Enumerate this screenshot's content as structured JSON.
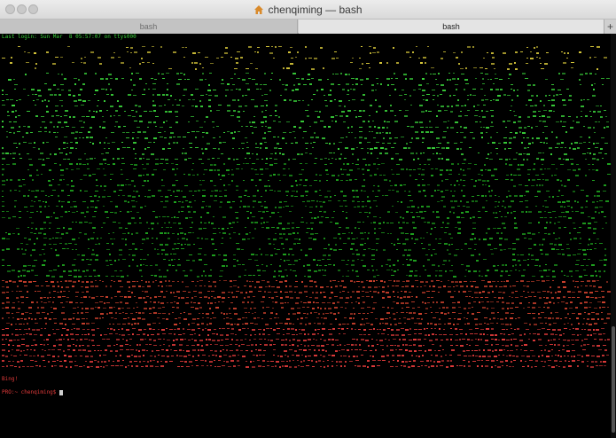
{
  "window": {
    "title": "chenqiming — bash",
    "title_icon": "home-icon"
  },
  "tabs": [
    {
      "label": "bash",
      "active": false
    },
    {
      "label": "bash",
      "active": true
    }
  ],
  "tab_add_label": "+",
  "terminal": {
    "login_line": "Last login: Sun Mar  8 05:57:07 on ttys000",
    "art_colors": {
      "top": "#d8c83a",
      "upper": "#39d13a",
      "middle": "#1fa31f",
      "lower": "#c9402c",
      "bottom": "#e03a3a"
    },
    "bing_line": "Bing!",
    "prompt_line": "PRO:~ chenqiming$ "
  }
}
